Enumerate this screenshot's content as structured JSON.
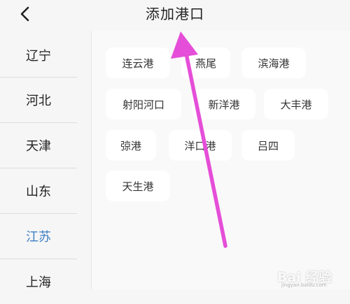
{
  "header": {
    "title": "添加港口",
    "back_icon": "chevron-left-icon"
  },
  "sidebar": {
    "items": [
      {
        "label": "辽宁",
        "active": false
      },
      {
        "label": "河北",
        "active": false
      },
      {
        "label": "天津",
        "active": false
      },
      {
        "label": "山东",
        "active": false
      },
      {
        "label": "江苏",
        "active": true
      },
      {
        "label": "上海",
        "active": false
      }
    ],
    "active_color": "#3d7fc4"
  },
  "ports": [
    {
      "label": "连云港"
    },
    {
      "label": "燕尾"
    },
    {
      "label": "滨海港"
    },
    {
      "label": "射阳河口"
    },
    {
      "label": "新洋港"
    },
    {
      "label": "大丰港"
    },
    {
      "label": "弶港"
    },
    {
      "label": "洋口港"
    },
    {
      "label": "吕四"
    },
    {
      "label": "天生港"
    }
  ],
  "annotation": {
    "arrow_color": "#e54ed8"
  },
  "watermark": {
    "main": "Bai 经验",
    "sub": "jingyan.baidu.com"
  }
}
